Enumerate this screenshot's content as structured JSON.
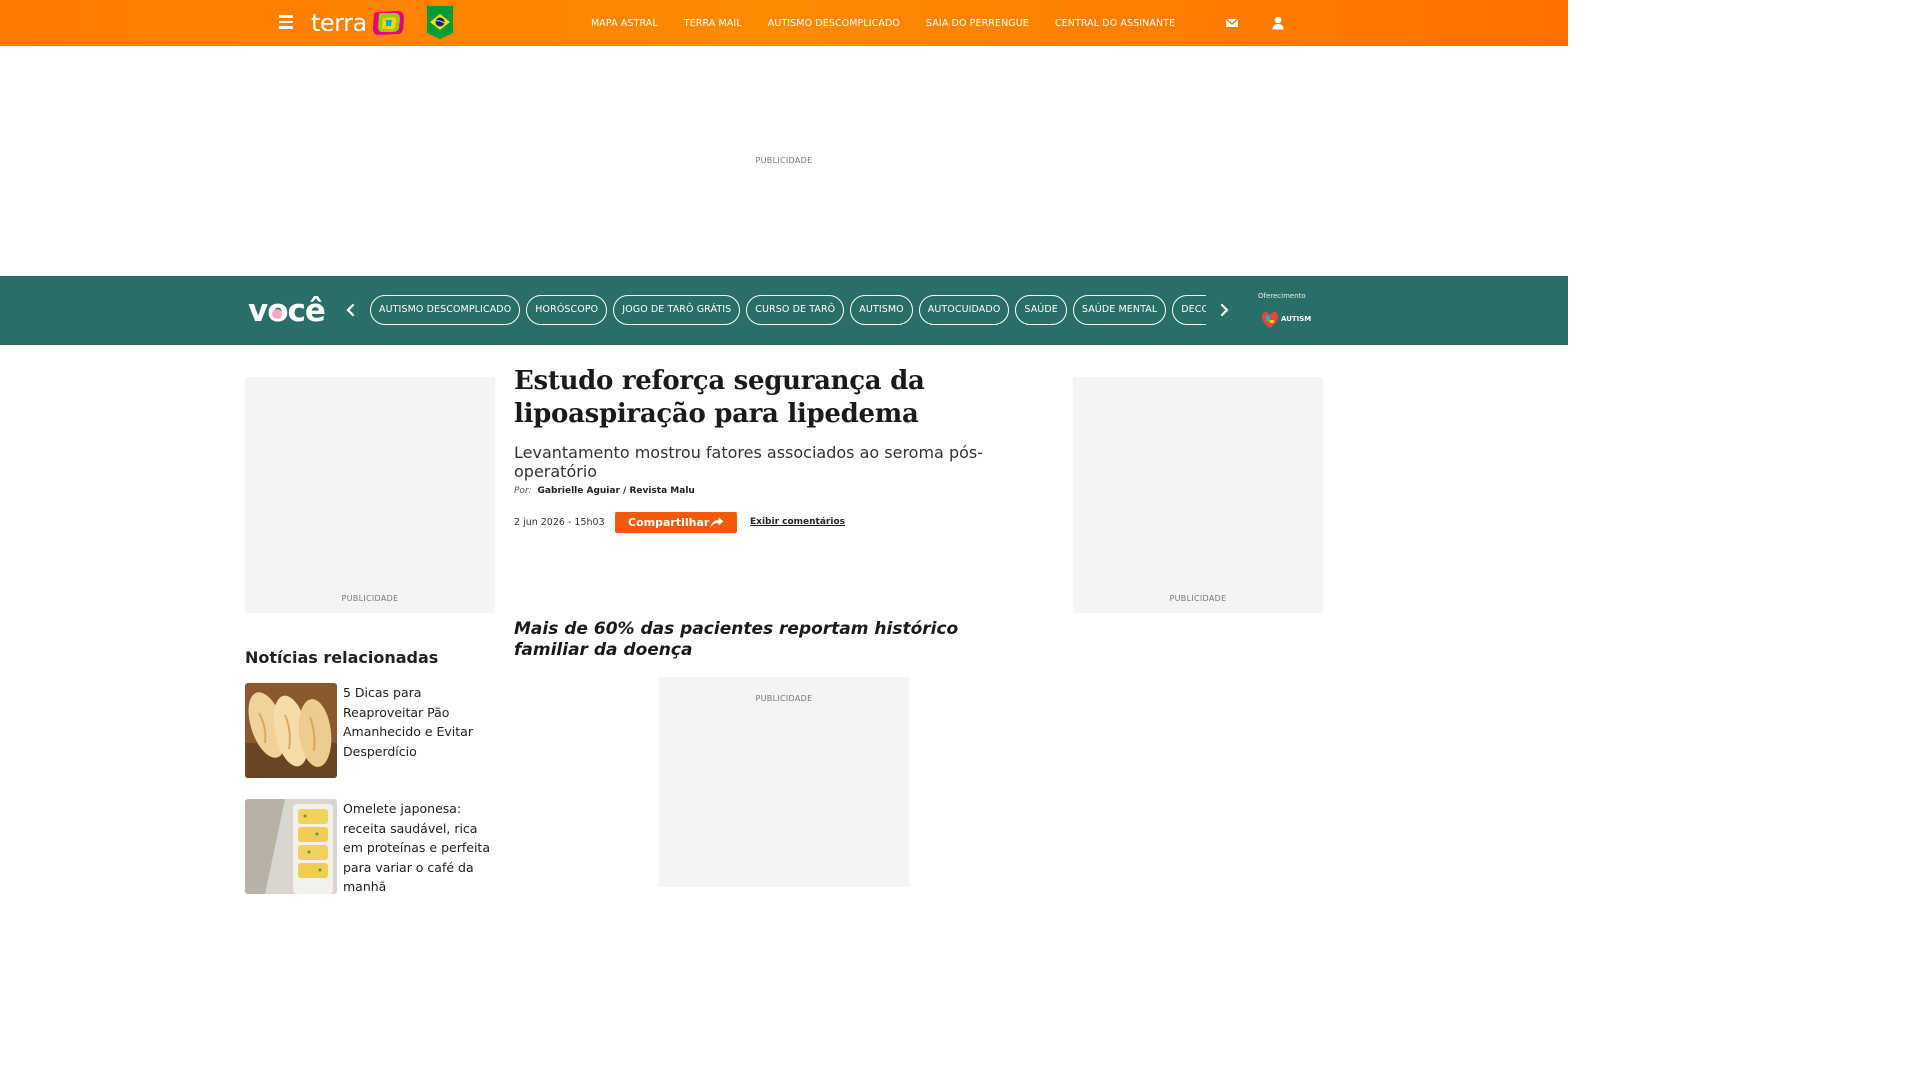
{
  "header": {
    "logo_text": "terra",
    "nav": [
      "MAPA ASTRAL",
      "TERRA MAIL",
      "AUTISMO DESCOMPLICADO",
      "SAIA DO PERRENGUE",
      "CENTRAL DO ASSINANTE"
    ]
  },
  "ads": {
    "top_label": "PUBLICIDADE",
    "left_label": "PUBLICIDADE",
    "right_label": "PUBLICIDADE",
    "mid_label": "PUBLICIDADE"
  },
  "section": {
    "logo_text": "você",
    "chips": [
      "AUTISMO DESCOMPLICADO",
      "HORÓSCOPO",
      "JOGO DE TARÔ GRÁTIS",
      "CURSO DE TARÔ",
      "AUTISMO",
      "AUTOCUIDADO",
      "SAÚDE",
      "SAÚDE MENTAL",
      "DECORAÇÃO"
    ],
    "sponsor_label": "Oferecimento",
    "sponsor_logo_text": "AUTISMO"
  },
  "article": {
    "headline": "Estudo reforça segurança da lipoaspiração para lipedema",
    "subtitle": "Levantamento mostrou fatores associados ao seroma pós-operatório",
    "byline_prefix": "Por:",
    "byline_author": "Gabrielle Aguiar / Revista Malu",
    "date": "2 jun 2026 - 15h03",
    "share_label": "Compartilhar",
    "comments_label": "Exibir comentários",
    "section_heading": "Mais de 60% das pacientes reportam histórico familiar da doença"
  },
  "related": {
    "title": "Notícias relacionadas",
    "items": [
      {
        "title": "5 Dicas para Reaproveitar Pão Amanhecido e Evitar Desperdício"
      },
      {
        "title": "Omelete japonesa: receita saudável, rica em proteínas e perfeita para variar o café da manhã"
      }
    ]
  },
  "colors": {
    "header_orange": "#ff7a00",
    "section_teal": "#2a6f67",
    "share_button": "#f15a0a"
  }
}
